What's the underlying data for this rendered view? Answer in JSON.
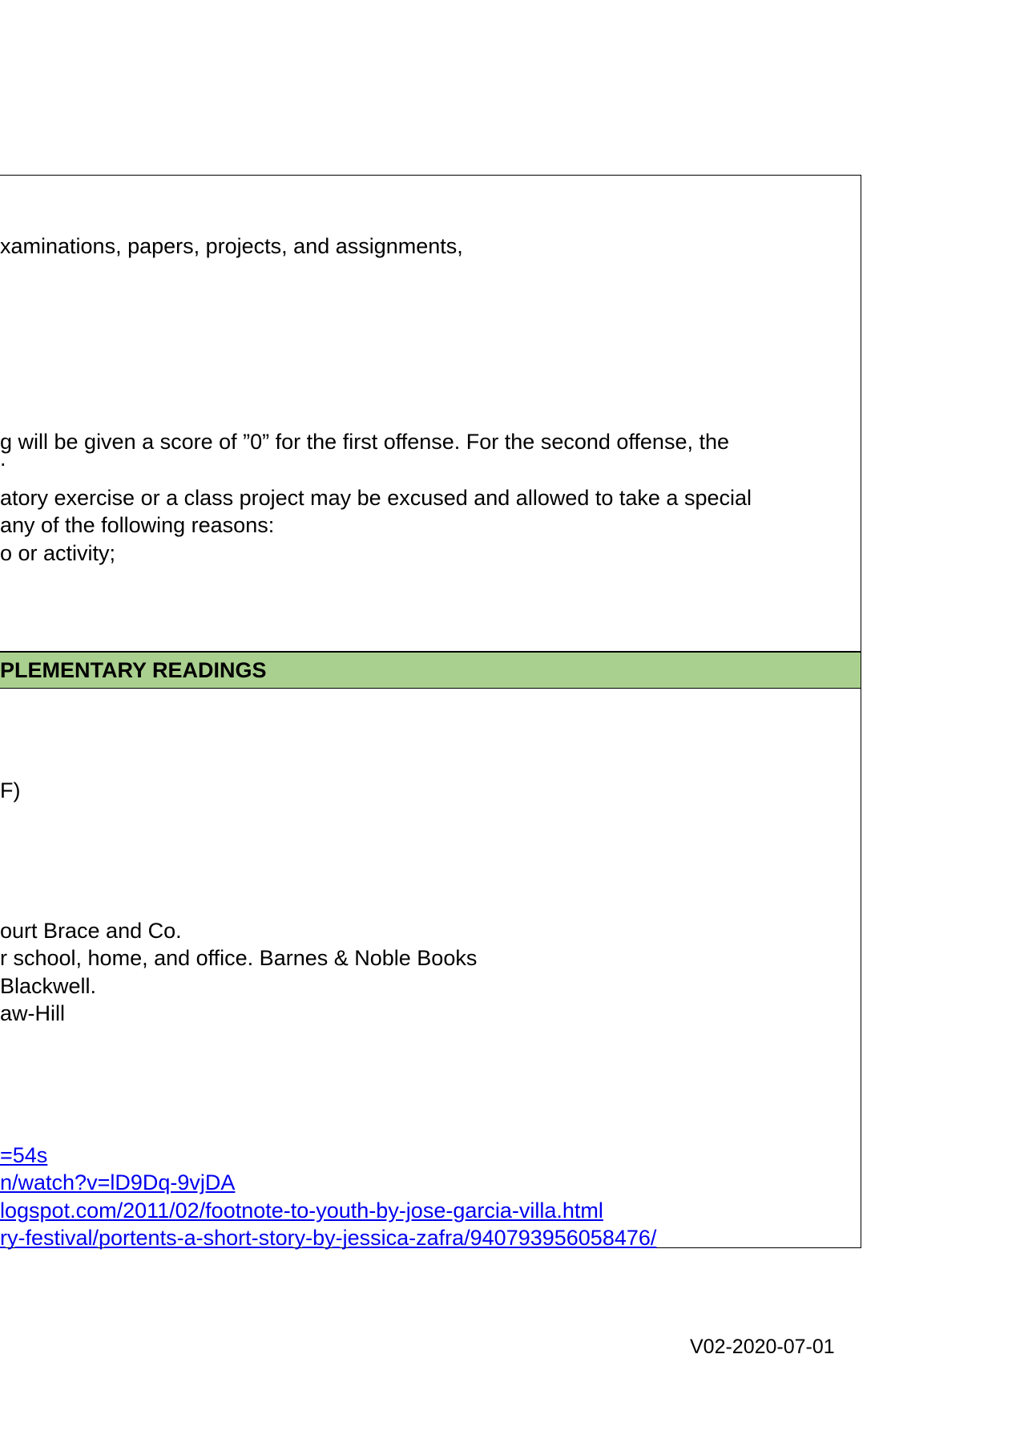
{
  "section1": {
    "lines": [
      "xaminations, papers, projects, and assignments,",
      "g will be given a score of ”0” for the first offense. For the second offense, the",
      ".",
      "atory exercise or a class project may be excused and allowed to take a special",
      " any of the following reasons:",
      "o or activity;"
    ]
  },
  "section2": {
    "header": "PLEMENTARY READINGS"
  },
  "section3": {
    "lines": [
      "F)",
      "ourt Brace and Co.",
      "r school, home, and office. Barnes & Noble Books",
      " Blackwell.",
      "aw-Hill"
    ],
    "links": [
      "=54s",
      "n/watch?v=lD9Dq-9vjDA",
      "logspot.com/2011/02/footnote-to-youth-by-jose-garcia-villa.html",
      "ry-festival/portents-a-short-story-by-jessica-zafra/940793956058476/"
    ]
  },
  "footer": {
    "version": "V02-2020-07-01"
  }
}
